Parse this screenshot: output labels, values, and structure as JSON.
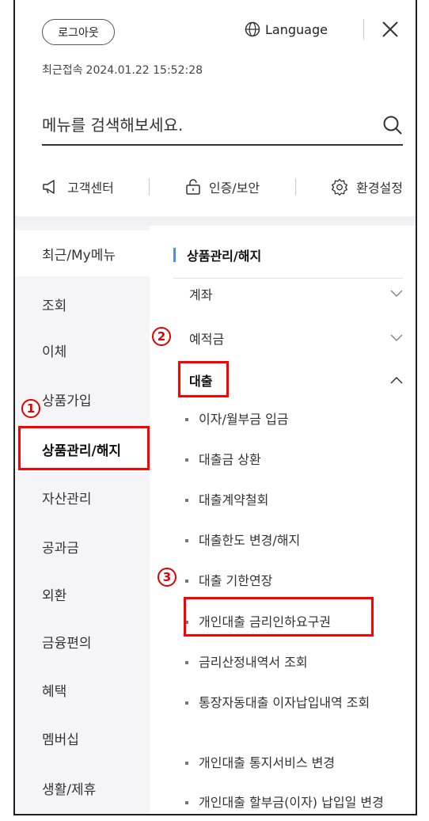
{
  "header": {
    "logout_label": "로그아웃",
    "language_label": "Language",
    "last_login_label": "최근접속",
    "last_login_value": "2024.01.22 15:52:28"
  },
  "search": {
    "placeholder": "메뉴를 검색해보세요."
  },
  "quick_links": [
    {
      "label": "고객센터",
      "icon": "megaphone-icon"
    },
    {
      "label": "인증/보안",
      "icon": "lock-icon"
    },
    {
      "label": "환경설정",
      "icon": "gear-icon"
    }
  ],
  "left_menu": [
    "최근/My메뉴",
    "조회",
    "이체",
    "상품가입",
    "상품관리/해지",
    "자산관리",
    "공과금",
    "외환",
    "금융편의",
    "혜택",
    "멤버십",
    "생활/제휴"
  ],
  "right_panel": {
    "section_title": "상품관리/해지",
    "categories": [
      {
        "label": "계좌",
        "state": "collapsed"
      },
      {
        "label": "예적금",
        "state": "collapsed"
      },
      {
        "label": "대출",
        "state": "expanded"
      }
    ],
    "loan_items": [
      "이자/월부금 입금",
      "대출금 상환",
      "대출계약철회",
      "대출한도 변경/해지",
      "대출 기한연장",
      "개인대출 금리인하요구권",
      "금리산정내역서 조회",
      "통장자동대출 이자납입내역 조회",
      "개인대출 통지서비스 변경",
      "개인대출 할부금(이자) 납입일 변경"
    ]
  },
  "annotations": {
    "step1": "1",
    "step2": "2",
    "step3": "3",
    "highlight_color": "#ff0000"
  },
  "colors": {
    "accent_bar": "#4a8ff0",
    "left_nav_bg": "#f5f5f7"
  }
}
